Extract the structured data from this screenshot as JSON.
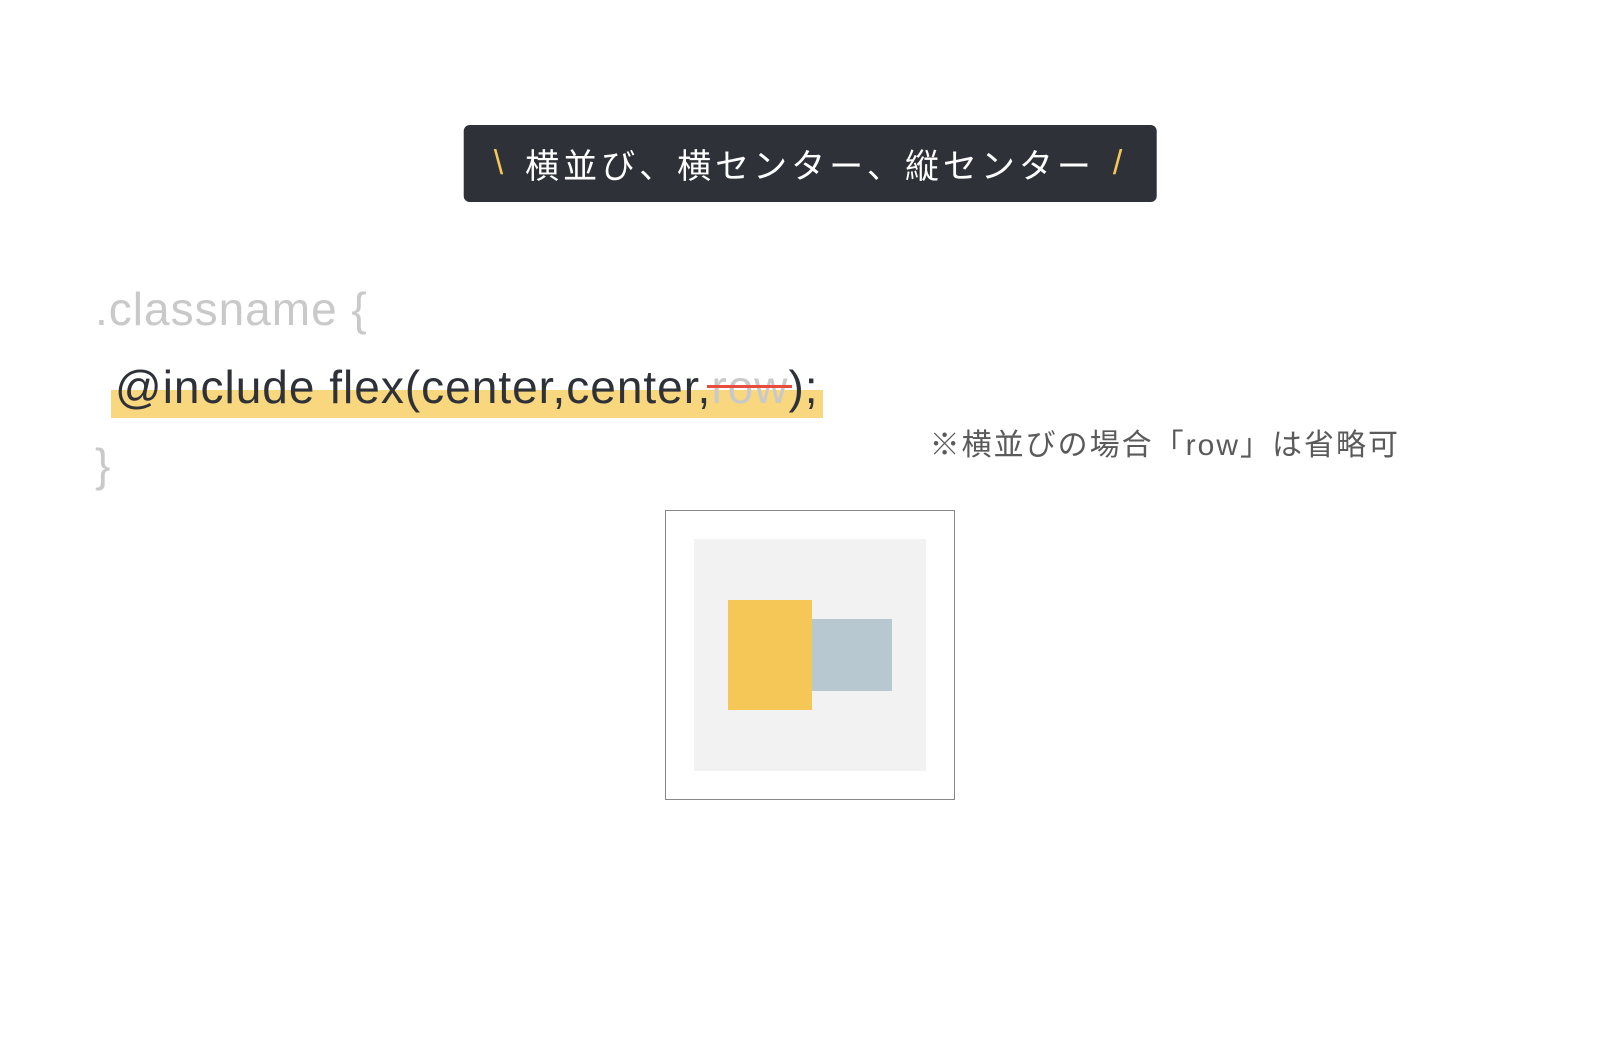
{
  "header": {
    "slash_left": "\\",
    "title": "横並び、横センター、縦センター",
    "slash_right": "/"
  },
  "code": {
    "line1": ".classname {",
    "line2_prefix": "@include flex(center,center,",
    "line2_struck": "row",
    "line2_suffix": ");",
    "line3": "}"
  },
  "note": "※横並びの場合「row」は省略可",
  "diagram": {
    "colors": {
      "yellow": "#f4c757",
      "blue": "#b8c8d0",
      "inner_bg": "#f2f2f2"
    }
  }
}
